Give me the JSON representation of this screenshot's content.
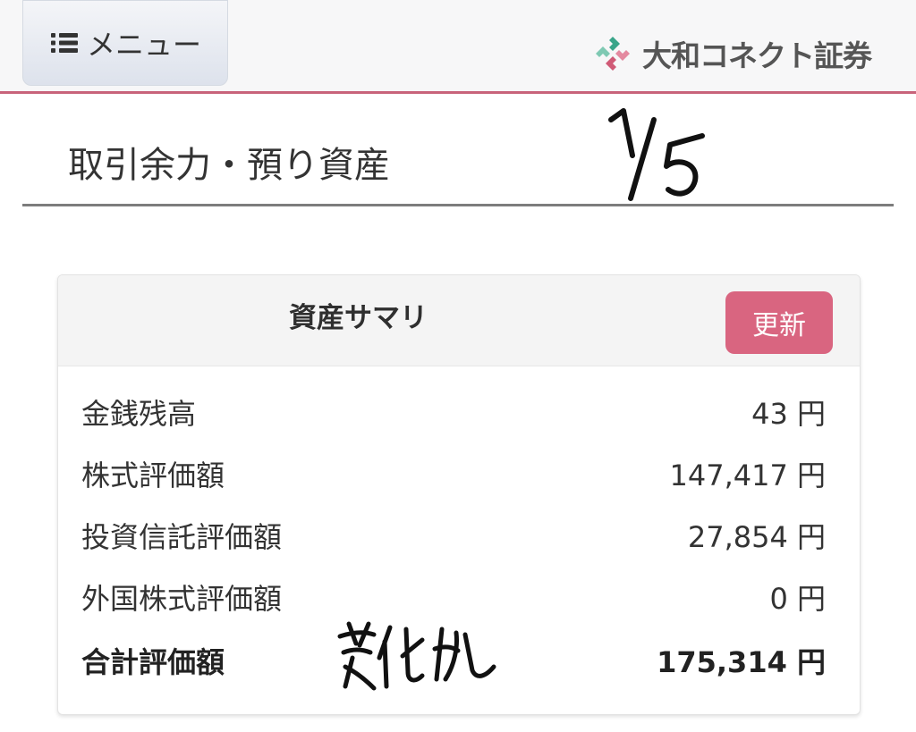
{
  "header": {
    "menu_label": "メニュー",
    "menu_icon": "list-icon",
    "logo_text": "大和コネクト証券",
    "logo_icon": "daiwa-connect-logo",
    "accent_color": "#c8637a"
  },
  "page": {
    "title": "取引余力・預り資産",
    "handwritten_page_note": "1/5"
  },
  "summary": {
    "title": "資産サマリ",
    "refresh_label": "更新",
    "refresh_color": "#d96580",
    "rows": [
      {
        "label": "金銭残高",
        "value": "43",
        "unit": "円"
      },
      {
        "label": "株式評価額",
        "value": "147,417",
        "unit": "円"
      },
      {
        "label": "投資信託評価額",
        "value": "27,854",
        "unit": "円"
      },
      {
        "label": "外国株式評価額",
        "value": "0",
        "unit": "円"
      }
    ],
    "total": {
      "label": "合計評価額",
      "value": "175,314",
      "unit": "円"
    },
    "handwritten_note": "変化なし"
  }
}
